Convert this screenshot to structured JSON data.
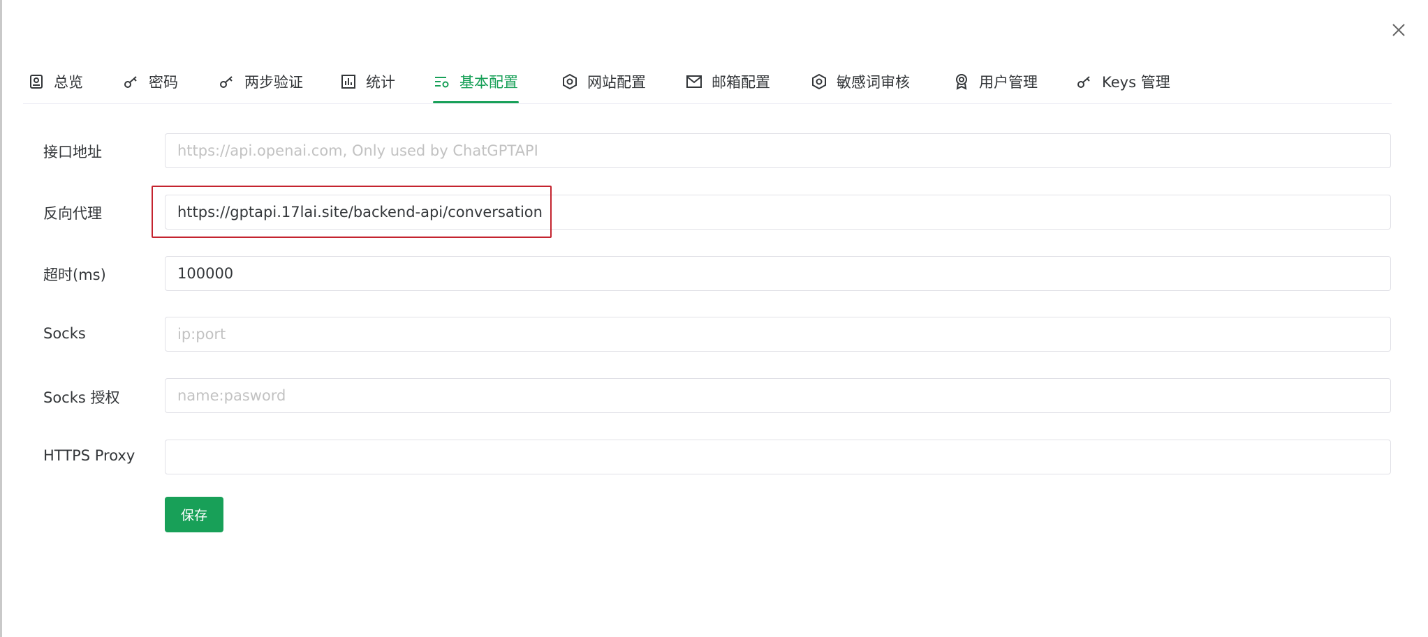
{
  "modal": {
    "close_label": "×"
  },
  "tabs": [
    {
      "label": "总览",
      "icon": "overview-icon",
      "active": false
    },
    {
      "label": "密码",
      "icon": "key-icon",
      "active": false
    },
    {
      "label": "两步验证",
      "icon": "key-icon",
      "active": false
    },
    {
      "label": "统计",
      "icon": "bar-chart-icon",
      "active": false
    },
    {
      "label": "基本配置",
      "icon": "settings-list-icon",
      "active": true
    },
    {
      "label": "网站配置",
      "icon": "hexagon-icon",
      "active": false
    },
    {
      "label": "邮箱配置",
      "icon": "mail-icon",
      "active": false
    },
    {
      "label": "敏感词审核",
      "icon": "hexagon-icon",
      "active": false
    },
    {
      "label": "用户管理",
      "icon": "award-icon",
      "active": false
    },
    {
      "label": "Keys 管理",
      "icon": "key-icon",
      "active": false
    }
  ],
  "form": {
    "api_url": {
      "label": "接口地址",
      "value": "",
      "placeholder": "https://api.openai.com, Only used by ChatGPTAPI"
    },
    "reverse_proxy": {
      "label": "反向代理",
      "value": "https://gptapi.17lai.site/backend-api/conversation",
      "placeholder": ""
    },
    "timeout": {
      "label": "超时(ms)",
      "value": "100000",
      "placeholder": ""
    },
    "socks": {
      "label": "Socks",
      "value": "",
      "placeholder": "ip:port"
    },
    "socks_auth": {
      "label": "Socks 授权",
      "value": "",
      "placeholder": "name:pasword"
    },
    "https_proxy": {
      "label": "HTTPS Proxy",
      "value": "",
      "placeholder": ""
    }
  },
  "save_label": "保存",
  "colors": {
    "accent": "#18a058",
    "highlight": "#c4242f",
    "text": "#333639",
    "placeholder": "#c2c2c2"
  }
}
